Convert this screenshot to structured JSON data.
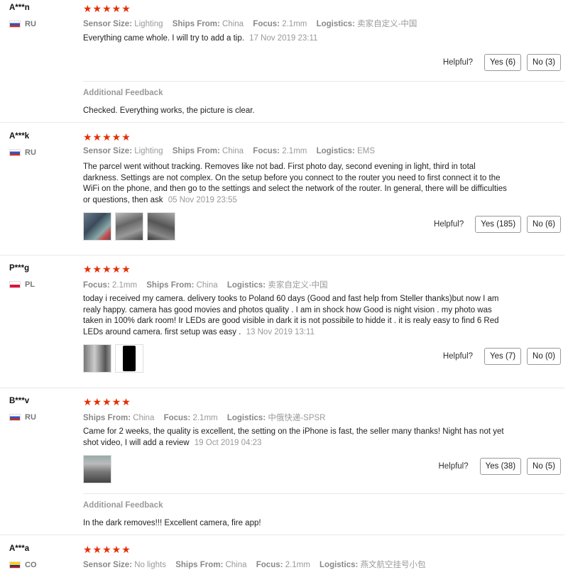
{
  "helpful_label": "Helpful?",
  "additional_feedback_label": "Additional Feedback",
  "labels": {
    "sensor_size": "Sensor Size:",
    "ships_from": "Ships From:",
    "focus": "Focus:",
    "logistics": "Logistics:"
  },
  "reviews": [
    {
      "user": "A***n",
      "country": "RU",
      "stars": "★★★★★",
      "sensor_size": "Lighting",
      "ships_from": "China",
      "focus": "2.1mm",
      "logistics": "卖家自定义-中国",
      "text": "Everything came whole. I will try to add a tip.",
      "date": "17 Nov 2019 23:11",
      "yes": "Yes (6)",
      "no": "No (3)",
      "feedback": "Checked. Everything works, the picture is clear."
    },
    {
      "user": "A***k",
      "country": "RU",
      "stars": "★★★★★",
      "sensor_size": "Lighting",
      "ships_from": "China",
      "focus": "2.1mm",
      "logistics": "EMS",
      "text": "The parcel went without tracking. Removes like not bad. First photo day, second evening in light, third in total darkness. Settings are not complex. On the setup before you connect to the router you need to first connect it to the WiFi on the phone, and then go to the settings and select the network of the router. In general, there will be difficulties or questions, then ask",
      "date": "05 Nov 2019 23:55",
      "yes": "Yes (185)",
      "no": "No (6)"
    },
    {
      "user": "P***g",
      "country": "PL",
      "stars": "★★★★★",
      "focus": "2.1mm",
      "ships_from": "China",
      "logistics": "卖家自定义-中国",
      "text": "today i received my camera. delivery tooks to Poland 60 days (Good and fast help from Steller thanks)but now I am realy happy. camera has good movies and photos quality . I am in shock how Good is night vision . my photo was taken in 100% dark room! Ir LEDs are good visible in dark it is not possibile to hidde it . it is realy easy to find 6 Red LEDs around camera. first setup was easy .",
      "date": "13 Nov 2019 13:11",
      "yes": "Yes (7)",
      "no": "No (0)"
    },
    {
      "user": "B***v",
      "country": "RU",
      "stars": "★★★★★",
      "ships_from": "China",
      "focus": "2.1mm",
      "logistics": "中俄快递-SPSR",
      "text": "Came for 2 weeks, the quality is excellent, the setting on the iPhone is fast, the seller many thanks! Night has not yet shot video, I will add a review",
      "date": "19 Oct 2019 04:23",
      "yes": "Yes (38)",
      "no": "No (5)",
      "feedback": "In the dark removes!!! Excellent camera, fire app!"
    },
    {
      "user": "A***a",
      "country": "CO",
      "stars": "★★★★★",
      "sensor_size": "No lights",
      "ships_from": "China",
      "focus": "2.1mm",
      "logistics": "燕文航空挂号小包"
    }
  ]
}
